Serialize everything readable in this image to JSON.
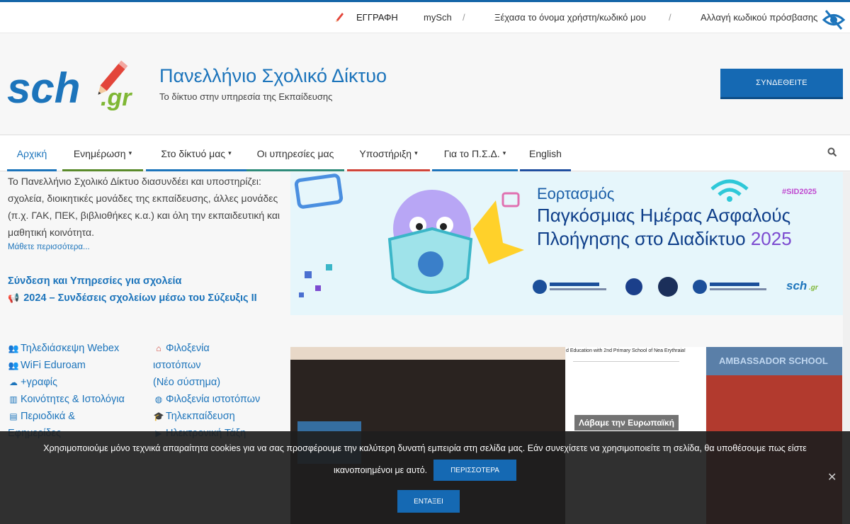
{
  "topbar": {
    "register": "ΕΓΓΡΑΦΗ",
    "mysch": "mySch",
    "separator": "/",
    "forgot": "Ξέχασα το όνομα χρήστη/κωδικό μου",
    "change_password": "Αλλαγή κωδικού πρόσβασης",
    "accessibility_icon": "eye-accessibility-icon"
  },
  "header": {
    "logo_main": "sch",
    "logo_suffix": ".gr",
    "title": "Πανελλήνιο Σχολικό Δίκτυο",
    "subtitle": "Το δίκτυο στην υπηρεσία της Εκπαίδευσης",
    "login_button": "ΣΥΝΔΕΘΕΙΤΕ"
  },
  "nav": {
    "items": [
      {
        "label": "Αρχική",
        "dropdown": false,
        "color": "#1c74bb"
      },
      {
        "label": "Ενημέρωση",
        "dropdown": true,
        "color": "#5a8a2b"
      },
      {
        "label": "Στο δίκτυό μας",
        "dropdown": true,
        "color": "#1c74bb"
      },
      {
        "label": "Οι υπηρεσίες μας",
        "dropdown": false,
        "color": "#2e8b7a"
      },
      {
        "label": "Υποστήριξη",
        "dropdown": true,
        "color": "#d0453a"
      },
      {
        "label": "Για το Π.Σ.Δ.",
        "dropdown": true,
        "color": "#1c74bb"
      },
      {
        "label": "English",
        "dropdown": false,
        "color": "#1f4fa0"
      }
    ],
    "caret": "▾",
    "search_icon": "search-icon"
  },
  "intro": {
    "text": "Το Πανελλήνιο Σχολικό Δίκτυο διασυνδέει και υποστηρίζει:  σχολεία, διοικητικές μονάδες της εκπαίδευσης,  άλλες μονάδες (π.χ. ΓΑΚ, ΠΕΚ, βιβλιοθήκες κ.α.) και όλη την εκπαιδευτική και μαθητική κοινότητα.",
    "more": "Μάθετε περισσότερα..."
  },
  "schools": {
    "title": "Σύνδεση και Υπηρεσίες για σχολεία",
    "link": "2024 – Συνδέσεις σχολείων μέσω του Σύζευξις ΙΙ"
  },
  "services_left": [
    {
      "icon": "users-icon",
      "glyph": "👥",
      "label": "Τηλεδιάσκεψη Webex"
    },
    {
      "icon": "users-icon",
      "glyph": "👥",
      "label": "WiFi Eduroam"
    },
    {
      "icon": "cloud-upload-icon",
      "glyph": "☁",
      "label": "+γραφίς"
    },
    {
      "icon": "columns-icon",
      "glyph": "▥",
      "label": "Κοινότητες & Ιστολόγια"
    },
    {
      "icon": "book-icon",
      "glyph": "▤",
      "label": "Περιοδικά &"
    },
    {
      "icon": "",
      "glyph": "",
      "label": "Εφημερίδες"
    }
  ],
  "services_right": [
    {
      "icon": "home-icon",
      "glyph": "⌂",
      "label": "Φιλοξενία"
    },
    {
      "icon": "",
      "glyph": "",
      "label": "ιστοτόπων"
    },
    {
      "icon": "",
      "glyph": "",
      "label": "(Νέο σύστημα)"
    },
    {
      "icon": "globe-icon",
      "glyph": "◍",
      "label": "Φιλοξενία ιστοτόπων"
    },
    {
      "icon": "graduation-cap-icon",
      "glyph": "🎓",
      "label": "Τηλεκπαίδευση"
    },
    {
      "icon": "video-icon",
      "glyph": "▶",
      "label": "Ηλεκτρονική Τάξη"
    }
  ],
  "banner": {
    "line1": "Εορτασμός",
    "line2": "Παγκόσμιας Ημέρας Ασφαλούς",
    "line3a": "Πλοήγησης στο Διαδίκτυο ",
    "line3b": "2025",
    "hashtag": "#SID2025"
  },
  "news": {
    "caption": "Λάβαμε την Ευρωπαϊκή",
    "card2_header": "d Education with 2nd Primary School of Nea Erythraia!",
    "card3_header": "AMBASSADOR SCHOOL"
  },
  "cookie": {
    "line1": "Χρησιμοποιούμε μόνο τεχνικά απαραίτητα cookies για να σας προσφέρουμε την καλύτερη δυνατή εμπειρία στη σελίδα μας. Εάν συνεχίσετε να χρησιμοποιείτε τη σελίδα, θα υποθέσουμε πως είστε",
    "line2": "ικανοποιημένοι με αυτό.",
    "more_button": "ΠΕΡΙΣΣΟΤΕΡΑ",
    "ok_button": "ΕΝΤΑΞΕΙ",
    "close": "✕"
  },
  "colors": {
    "brand_blue": "#1c74bb",
    "button_blue": "#1569b3"
  }
}
